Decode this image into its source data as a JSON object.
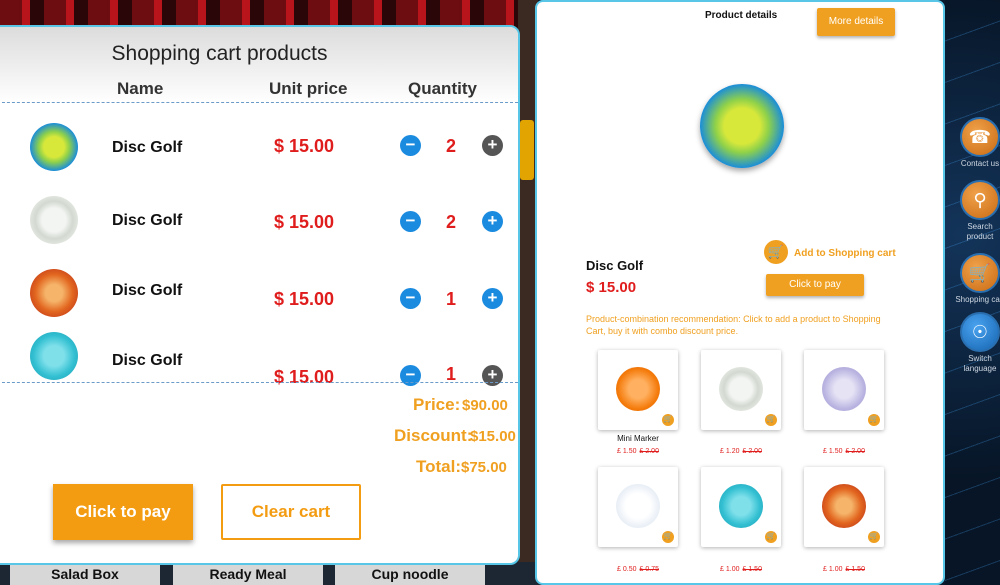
{
  "background": {
    "tiles": [
      "Salad Box",
      "Ready Meal",
      "Cup noodle"
    ]
  },
  "side_nav": [
    {
      "label": "Contact us",
      "icon": "phone-icon"
    },
    {
      "label": "Search product",
      "icon": "search-icon"
    },
    {
      "label": "Shopping cart",
      "icon": "cart-icon"
    },
    {
      "label": "Switch language",
      "icon": "globe-icon"
    }
  ],
  "cart": {
    "title": "Shopping cart products",
    "headers": {
      "name": "Name",
      "unit_price": "Unit price",
      "quantity": "Quantity"
    },
    "rows": [
      {
        "name": "Disc Golf",
        "price": "$ 15.00",
        "qty": "2",
        "image": "mamba-disc"
      },
      {
        "name": "Disc Golf",
        "price": "$ 15.00",
        "qty": "2",
        "image": "white-disc"
      },
      {
        "name": "Disc Golf",
        "price": "$ 15.00",
        "qty": "1",
        "image": "orange-disc"
      },
      {
        "name": "Disc Golf",
        "price": "$ 15.00",
        "qty": "1",
        "image": "teal-disc"
      }
    ],
    "summary": {
      "price_label": "Price:",
      "price_value": "$90.00",
      "discount_label": "Discount:",
      "discount_value": "$15.00",
      "total_label": "Total:",
      "total_value": "$75.00"
    },
    "buttons": {
      "pay": "Click to pay",
      "clear": "Clear cart"
    }
  },
  "details": {
    "title": "Product details",
    "more_button": "More details",
    "product_name": "Disc Golf",
    "product_price": "$ 15.00",
    "add_to_cart": "Add to Shopping cart",
    "pay_button": "Click to pay",
    "combo_text": "Product-combination recommendation: Click to add a product to Shopping Cart, buy it with combo discount price.",
    "combo_items": [
      {
        "label": "Mini Marker",
        "price": "£ 1.50",
        "old_price": "£ 2.00",
        "image": "marker-disc"
      },
      {
        "label": "",
        "price": "£ 1.20",
        "old_price": "£ 2.00",
        "image": "white-disc"
      },
      {
        "label": "",
        "price": "£ 1.50",
        "old_price": "£ 2.00",
        "image": "purple-disc"
      },
      {
        "label": "",
        "price": "£ 0.50",
        "old_price": "£ 0.75",
        "image": "world-disc"
      },
      {
        "label": "",
        "price": "£ 1.00",
        "old_price": "£ 1.50",
        "image": "teal-disc"
      },
      {
        "label": "",
        "price": "£ 1.00",
        "old_price": "£ 1.50",
        "image": "orange-disc"
      }
    ]
  },
  "colors": {
    "accent_orange": "#f39c12",
    "price_red": "#e01d1d",
    "qty_blue": "#1b8be0",
    "panel_border": "#58c6e6"
  }
}
